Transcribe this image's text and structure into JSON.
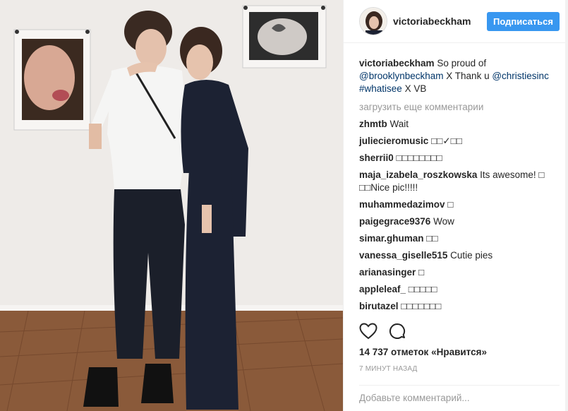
{
  "header": {
    "username": "victoriabeckham",
    "follow_label": "Подписаться"
  },
  "caption": {
    "username": "victoriabeckham",
    "text_1": "So proud of",
    "mention_1": "@brooklynbeckham",
    "text_2": "X Thank u",
    "mention_2": "@christiesinc",
    "hashtag": "#whatisee",
    "text_3": "X VB"
  },
  "load_more_label": "загрузить еще комментарии",
  "comments": [
    {
      "user": "zhmtb",
      "text": "Wait"
    },
    {
      "user": "juliecieromusic",
      "text": "□□✓□□"
    },
    {
      "user": "sherrii0",
      "text": "□□□□□□□□"
    },
    {
      "user": "maja_izabela_roszkowska",
      "text": "Its awesome! □ □□Nice pic!!!!!"
    },
    {
      "user": "muhammedazimov",
      "text": "□"
    },
    {
      "user": "paigegrace9376",
      "text": "Wow"
    },
    {
      "user": "simar.ghuman",
      "text": "□□"
    },
    {
      "user": "vanessa_giselle515",
      "text": "Cutie pies"
    },
    {
      "user": "arianasinger",
      "text": "□"
    },
    {
      "user": "appleleaf_",
      "text": "□□□□□"
    },
    {
      "user": "birutazel",
      "text": "□□□□□□□"
    }
  ],
  "actions": {
    "like_icon": "heart-icon",
    "comment_icon": "comment-icon"
  },
  "likes_label": "14 737 отметок «Нравится»",
  "timestamp": "7 МИНУТ НАЗАД",
  "add_comment_placeholder": "Добавьте комментарий..."
}
